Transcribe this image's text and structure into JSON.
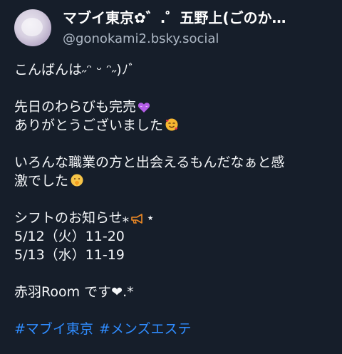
{
  "post": {
    "display_name": "マブイ東京✿゛.゜五野上(ごのか…",
    "handle": "@gonokami2.bsky.social",
    "text": {
      "greeting": "こんばんは˶ᵔ ᵕ ᵔ˶)ﾉﾞ",
      "line_sold_out": "先日のわらびも完売",
      "line_thanks": "ありがとうございました",
      "line_met_1": "いろんな職業の方と出会えるもんだなぁと感",
      "line_met_2": "激でした",
      "line_shift": "シフトのお知らせ",
      "shift_star_left": "⁎",
      "shift_star_right": "⋆",
      "shift_1": "5/12（火）11-20",
      "shift_2": "5/13（水）11-19",
      "line_room": "赤羽Room です❤︎.*"
    },
    "hashtags": [
      "#マブイ東京",
      "#メンズエステ"
    ],
    "emoji_icons": [
      "purple-heart-icon",
      "smiling-face-with-hearts-icon",
      "shushing-face-icon",
      "megaphone-icon"
    ],
    "colors": {
      "background": "#161e2a",
      "text": "#f4f6f8",
      "handle": "#aeb8c5",
      "hashtag": "#2f8cff"
    }
  }
}
